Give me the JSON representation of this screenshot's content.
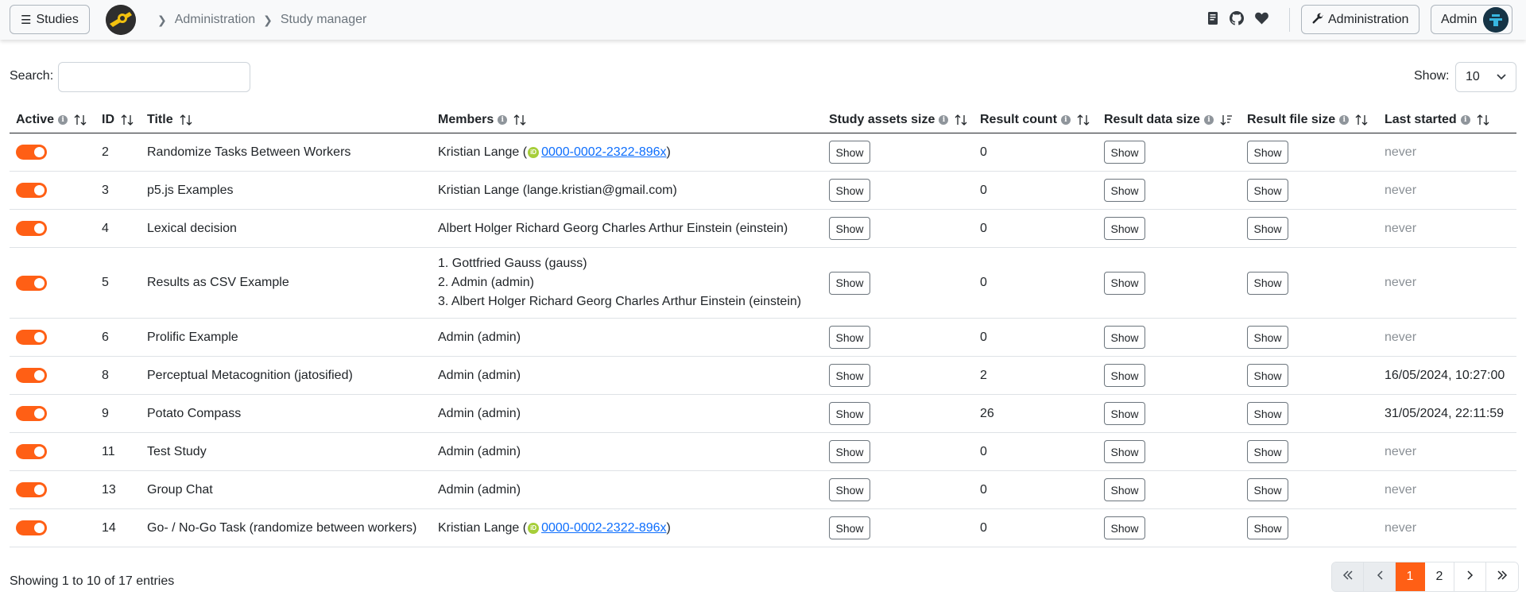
{
  "navbar": {
    "studies_label": "Studies",
    "breadcrumb": [
      "Administration",
      "Study manager"
    ],
    "administration_label": "Administration",
    "user_label": "Admin"
  },
  "controls": {
    "search_label": "Search:",
    "search_value": "",
    "show_label": "Show:",
    "page_size": "10"
  },
  "table": {
    "headers": [
      "Active",
      "ID",
      "Title",
      "Members",
      "Study assets size",
      "Result count",
      "Result data size",
      "Result file size",
      "Last started"
    ],
    "show_label": "Show",
    "rows": [
      {
        "active": true,
        "id": "2",
        "title": "Randomize Tasks Between Workers",
        "members": [
          {
            "name": "Kristian Lange (",
            "orcid": "0000-0002-2322-896x",
            "suffix": ")"
          }
        ],
        "result_count": "0",
        "last_started": "never"
      },
      {
        "active": true,
        "id": "3",
        "title": "p5.js Examples",
        "members": [
          {
            "name": "Kristian Lange (lange.kristian@gmail.com)"
          }
        ],
        "result_count": "0",
        "last_started": "never"
      },
      {
        "active": true,
        "id": "4",
        "title": "Lexical decision",
        "members": [
          {
            "name": "Albert Holger Richard Georg Charles Arthur Einstein (einstein)"
          }
        ],
        "result_count": "0",
        "last_started": "never"
      },
      {
        "active": true,
        "id": "5",
        "title": "Results as CSV Example",
        "members": [
          {
            "name": "1. Gottfried Gauss (gauss)"
          },
          {
            "name": "2. Admin (admin)"
          },
          {
            "name": "3. Albert Holger Richard Georg Charles Arthur Einstein (einstein)"
          }
        ],
        "result_count": "0",
        "last_started": "never"
      },
      {
        "active": true,
        "id": "6",
        "title": "Prolific Example",
        "members": [
          {
            "name": "Admin (admin)"
          }
        ],
        "result_count": "0",
        "last_started": "never"
      },
      {
        "active": true,
        "id": "8",
        "title": "Perceptual Metacognition (jatosified)",
        "members": [
          {
            "name": "Admin (admin)"
          }
        ],
        "result_count": "2",
        "last_started": "16/05/2024, 10:27:00"
      },
      {
        "active": true,
        "id": "9",
        "title": "Potato Compass",
        "members": [
          {
            "name": "Admin (admin)"
          }
        ],
        "result_count": "26",
        "last_started": "31/05/2024, 22:11:59"
      },
      {
        "active": true,
        "id": "11",
        "title": "Test Study",
        "members": [
          {
            "name": "Admin (admin)"
          }
        ],
        "result_count": "0",
        "last_started": "never"
      },
      {
        "active": true,
        "id": "13",
        "title": "Group Chat",
        "members": [
          {
            "name": "Admin (admin)"
          }
        ],
        "result_count": "0",
        "last_started": "never"
      },
      {
        "active": true,
        "id": "14",
        "title": "Go- / No-Go Task (randomize between workers)",
        "members": [
          {
            "name": "Kristian Lange (",
            "orcid": "0000-0002-2322-896x",
            "suffix": ")"
          }
        ],
        "result_count": "0",
        "last_started": "never"
      }
    ]
  },
  "footer": {
    "info": "Showing 1 to 10 of 17 entries",
    "pages": [
      "1",
      "2"
    ],
    "current_page": "1"
  },
  "colors": {
    "accent": "#ff5f15",
    "link": "#0d6efd",
    "orcid": "#a6ce39"
  },
  "icons": [
    "hamburger-icon",
    "chevron-right-icon",
    "book-icon",
    "github-icon",
    "heart-icon",
    "wrench-icon",
    "chevron-down-icon",
    "info-icon",
    "sort-icon",
    "orcid-icon",
    "double-chevron-left-icon",
    "chevron-left-icon",
    "double-chevron-right-icon"
  ]
}
